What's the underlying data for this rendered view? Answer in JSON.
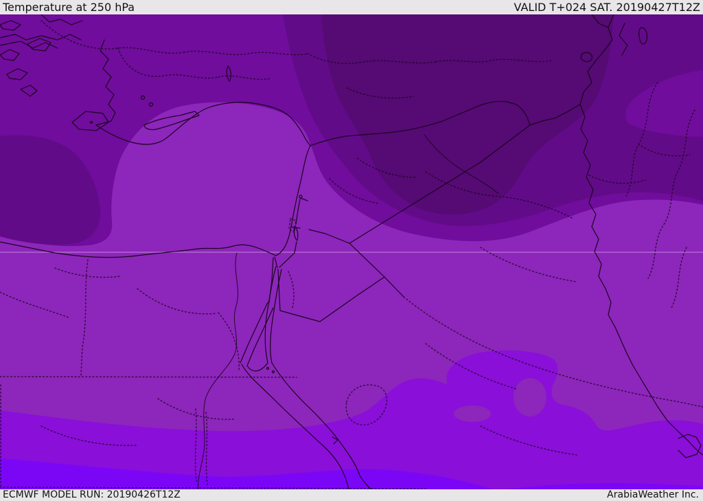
{
  "header": {
    "title": "Temperature at 250 hPa",
    "valid_time": "VALID T+024 SAT. 20190427T12Z"
  },
  "footer": {
    "model_run": "ECMWF MODEL RUN: 20190426T12Z",
    "brand": "ArabiaWeather Inc."
  },
  "map": {
    "parameter": "Temperature",
    "level": "250 hPa",
    "model": "ECMWF",
    "region": "Middle East / Eastern Mediterranean",
    "palette": {
      "band1_darkest": "#560a74",
      "band2_dark": "#620b88",
      "band3_upper": "#700d9c",
      "band4_middle": "#8d26bb",
      "band5_bright": "#8a0fd9",
      "band6_brightest": "#7b06f6"
    },
    "border_color": "#1a051e",
    "graticule_color": "rgba(240,233,248,0.5)",
    "bar_bg": "#e8e6e8",
    "text_color": "#131313"
  }
}
